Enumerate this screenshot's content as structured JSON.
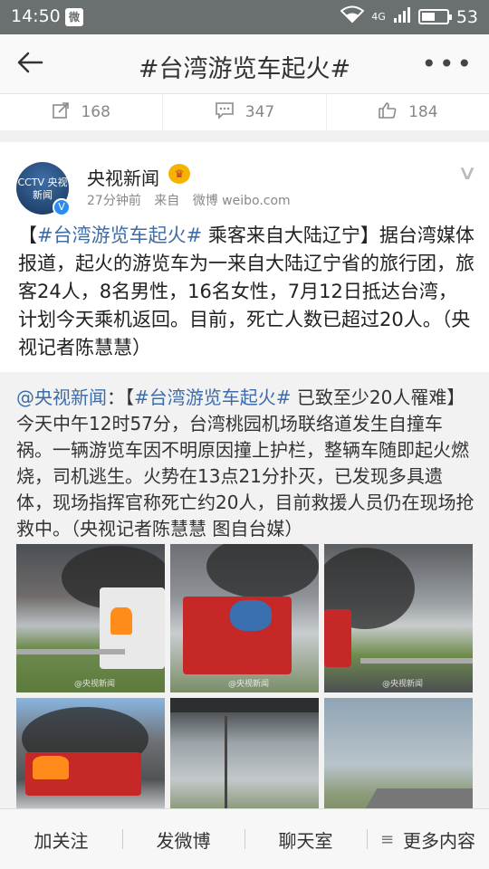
{
  "status_bar": {
    "time": "14:50",
    "app_badge": "微",
    "network": "4G",
    "battery_percent": "53",
    "battery_level": 0.53
  },
  "nav": {
    "title": "#台湾游览车起火#"
  },
  "actions": {
    "repost_count": "168",
    "comment_count": "347",
    "like_count": "184"
  },
  "post": {
    "avatar_text": "CCTV 央视新闻",
    "username": "央视新闻",
    "time_ago": "27分钟前",
    "source_prefix": "来自",
    "source": "微博 weibo.com",
    "text_open": "【",
    "hashtag": "#台湾游览车起火#",
    "text_body": " 乘客来自大陆辽宁】据台湾媒体报道，起火的游览车为一来自大陆辽宁省的旅行团，旅客24人，8名男性，16名女性，7月12日抵达台湾，计划今天乘机返回。目前，死亡人数已超过20人。（央视记者陈慧慧）"
  },
  "repost": {
    "mention": "@央视新闻",
    "sep": "：【",
    "hashtag": "#台湾游览车起火#",
    "text_body": " 已致至少20人罹难】今天中午12时57分，台湾桃园机场联络道发生自撞车祸。一辆游览车因不明原因撞上护栏，整辆车随即起火燃烧，司机逃生。火势在13点21分扑灭，已发现多具遗体，现场指挥官称死亡约20人，目前救援人员仍在现场抢救中。（央视记者陈慧慧 图自台媒）",
    "watermark": "@央视新闻"
  },
  "bottom_bar": {
    "follow": "加关注",
    "post": "发微博",
    "chat": "聊天室",
    "more": "更多内容"
  }
}
